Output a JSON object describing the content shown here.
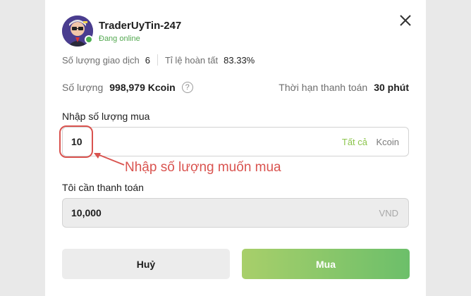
{
  "user": {
    "name": "TraderUyTin-247",
    "status": "Đang online",
    "online_color": "#4caf50",
    "avatar_icon": "avatar-cartoon-trader"
  },
  "stats": {
    "trades_label": "Số lượng giao dịch",
    "trades_value": "6",
    "completion_label": "Tỉ lệ hoàn tất",
    "completion_value": "83.33%"
  },
  "offer": {
    "amount_label": "Số lượng",
    "amount_value": "998,979 Kcoin",
    "help_icon": "question-circle-icon",
    "time_label": "Thời hạn thanh toán",
    "time_value": "30 phút"
  },
  "buy_input": {
    "label": "Nhập số lượng mua",
    "value": "10",
    "all_label": "Tất cả",
    "unit": "Kcoin"
  },
  "annotation": {
    "text": "Nhập số lượng muốn mua",
    "color": "#d9534f"
  },
  "payment": {
    "label": "Tôi cần thanh toán",
    "value": "10,000",
    "unit": "VND"
  },
  "buttons": {
    "cancel_label": "Huỷ",
    "buy_label": "Mua",
    "buy_color": "#8cc54c"
  },
  "close_icon": "close-icon"
}
